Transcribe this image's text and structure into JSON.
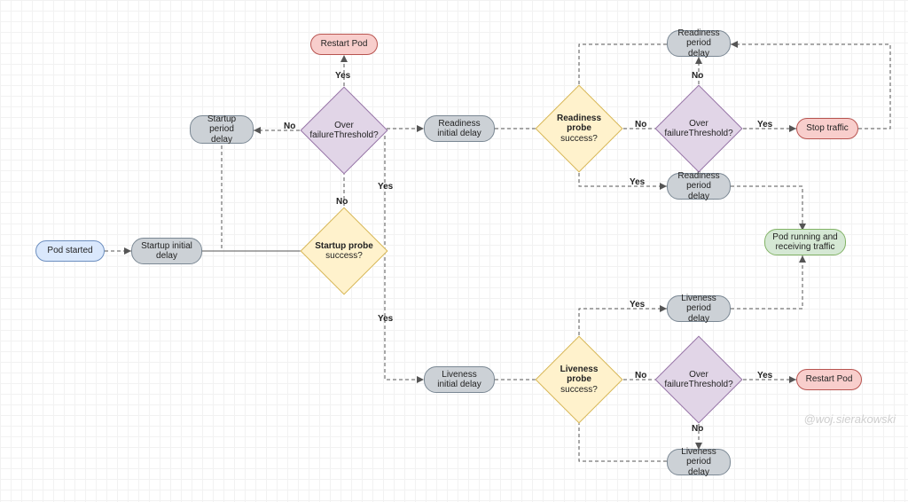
{
  "nodes": {
    "pod_started": {
      "l1": "Pod started"
    },
    "startup_initial_delay": {
      "l1": "Startup initial",
      "l2": "delay"
    },
    "startup_period_delay": {
      "l1": "Startup",
      "l2": "period delay"
    },
    "startup_probe": {
      "l1": "Startup probe",
      "l2": "success?"
    },
    "startup_threshold": {
      "l1": "Over",
      "l2": "failureThreshold?"
    },
    "restart_pod_top": {
      "l1": "Restart Pod"
    },
    "readiness_initial": {
      "l1": "Readiness",
      "l2": "initial delay"
    },
    "readiness_probe": {
      "l1": "Readiness",
      "l2": "probe",
      "l3": "success?"
    },
    "readiness_threshold": {
      "l1": "Over",
      "l2": "failureThreshold?"
    },
    "readiness_period_top": {
      "l1": "Readiness",
      "l2": "period delay"
    },
    "readiness_period_mid": {
      "l1": "Readiness",
      "l2": "period delay"
    },
    "stop_traffic": {
      "l1": "Stop traffic"
    },
    "pod_running": {
      "l1": "Pod running and",
      "l2": "receiving traffic"
    },
    "liveness_initial": {
      "l1": "Liveness",
      "l2": "initial delay"
    },
    "liveness_probe": {
      "l1": "Liveness",
      "l2": "probe",
      "l3": "success?"
    },
    "liveness_threshold": {
      "l1": "Over",
      "l2": "failureThreshold?"
    },
    "liveness_period_mid": {
      "l1": "Liveness",
      "l2": "period delay"
    },
    "liveness_period_bot": {
      "l1": "Liveness",
      "l2": "period delay"
    },
    "restart_pod_bot": {
      "l1": "Restart Pod"
    }
  },
  "labels": {
    "yes": "Yes",
    "no": "No"
  },
  "watermark": "@woj.sierakowski"
}
